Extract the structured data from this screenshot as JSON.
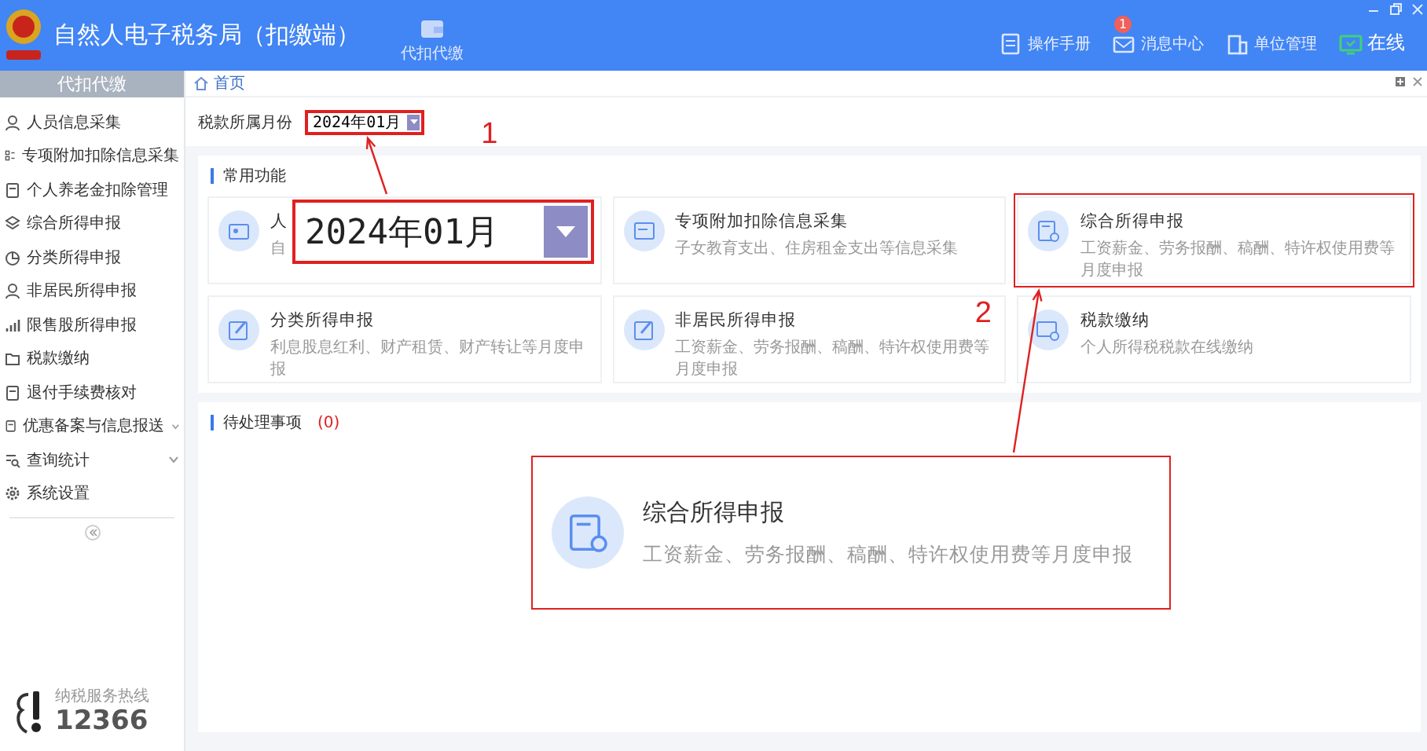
{
  "header": {
    "title": "自然人电子税务局（扣缴端）",
    "nav": [
      {
        "label": "代扣代缴"
      }
    ],
    "actions": [
      {
        "kind": "manual",
        "label": "操作手册"
      },
      {
        "kind": "message",
        "label": "消息中心",
        "badge": "1"
      },
      {
        "kind": "unit",
        "label": "单位管理"
      },
      {
        "kind": "online",
        "label": "在线"
      }
    ]
  },
  "sidebar": {
    "title": "代扣代缴",
    "items": [
      {
        "kind": "person",
        "label": "人员信息采集",
        "expandable": false
      },
      {
        "kind": "list",
        "label": "专项附加扣除信息采集",
        "expandable": false
      },
      {
        "kind": "doc",
        "label": "个人养老金扣除管理",
        "expandable": false
      },
      {
        "kind": "layers",
        "label": "综合所得申报",
        "expandable": false
      },
      {
        "kind": "pie",
        "label": "分类所得申报",
        "expandable": false
      },
      {
        "kind": "person",
        "label": "非居民所得申报",
        "expandable": false
      },
      {
        "kind": "chart",
        "label": "限售股所得申报",
        "expandable": false
      },
      {
        "kind": "folder",
        "label": "税款缴纳",
        "expandable": false
      },
      {
        "kind": "doc",
        "label": "退付手续费核对",
        "expandable": false
      },
      {
        "kind": "doc",
        "label": "优惠备案与信息报送",
        "expandable": true
      },
      {
        "kind": "search",
        "label": "查询统计",
        "expandable": true
      },
      {
        "kind": "gear",
        "label": "系统设置",
        "expandable": false
      }
    ],
    "hotline": {
      "label": "纳税服务热线",
      "number": "12366"
    }
  },
  "breadcrumb": "首页",
  "tax_month": {
    "label": "税款所属月份",
    "value": "2024年01月"
  },
  "common_functions": {
    "title": "常用功能",
    "cards": [
      {
        "kind": "card",
        "title": "人",
        "subtitle": "自"
      },
      {
        "kind": "calendar",
        "title": "专项附加扣除信息采集",
        "subtitle": "子女教育支出、住房租金支出等信息采集"
      },
      {
        "kind": "form",
        "title": "综合所得申报",
        "subtitle": "工资薪金、劳务报酬、稿酬、特许权使用费等月度申报"
      },
      {
        "kind": "edit",
        "title": "分类所得申报",
        "subtitle": "利息股息红利、财产租赁、财产转让等月度申报"
      },
      {
        "kind": "edit",
        "title": "非居民所得申报",
        "subtitle": "工资薪金、劳务报酬、稿酬、特许权使用费等月度申报"
      },
      {
        "kind": "payment",
        "title": "税款缴纳",
        "subtitle": "个人所得税税款在线缴纳"
      }
    ]
  },
  "pending": {
    "title": "待处理事项",
    "count": "(0)"
  },
  "annotations": {
    "marks": [
      "1",
      "2"
    ],
    "callout_date": {
      "value": "2024年01月"
    },
    "callout_card": {
      "kind": "form",
      "title": "综合所得申报",
      "subtitle": "工资薪金、劳务报酬、稿酬、特许权使用费等月度申报"
    }
  }
}
